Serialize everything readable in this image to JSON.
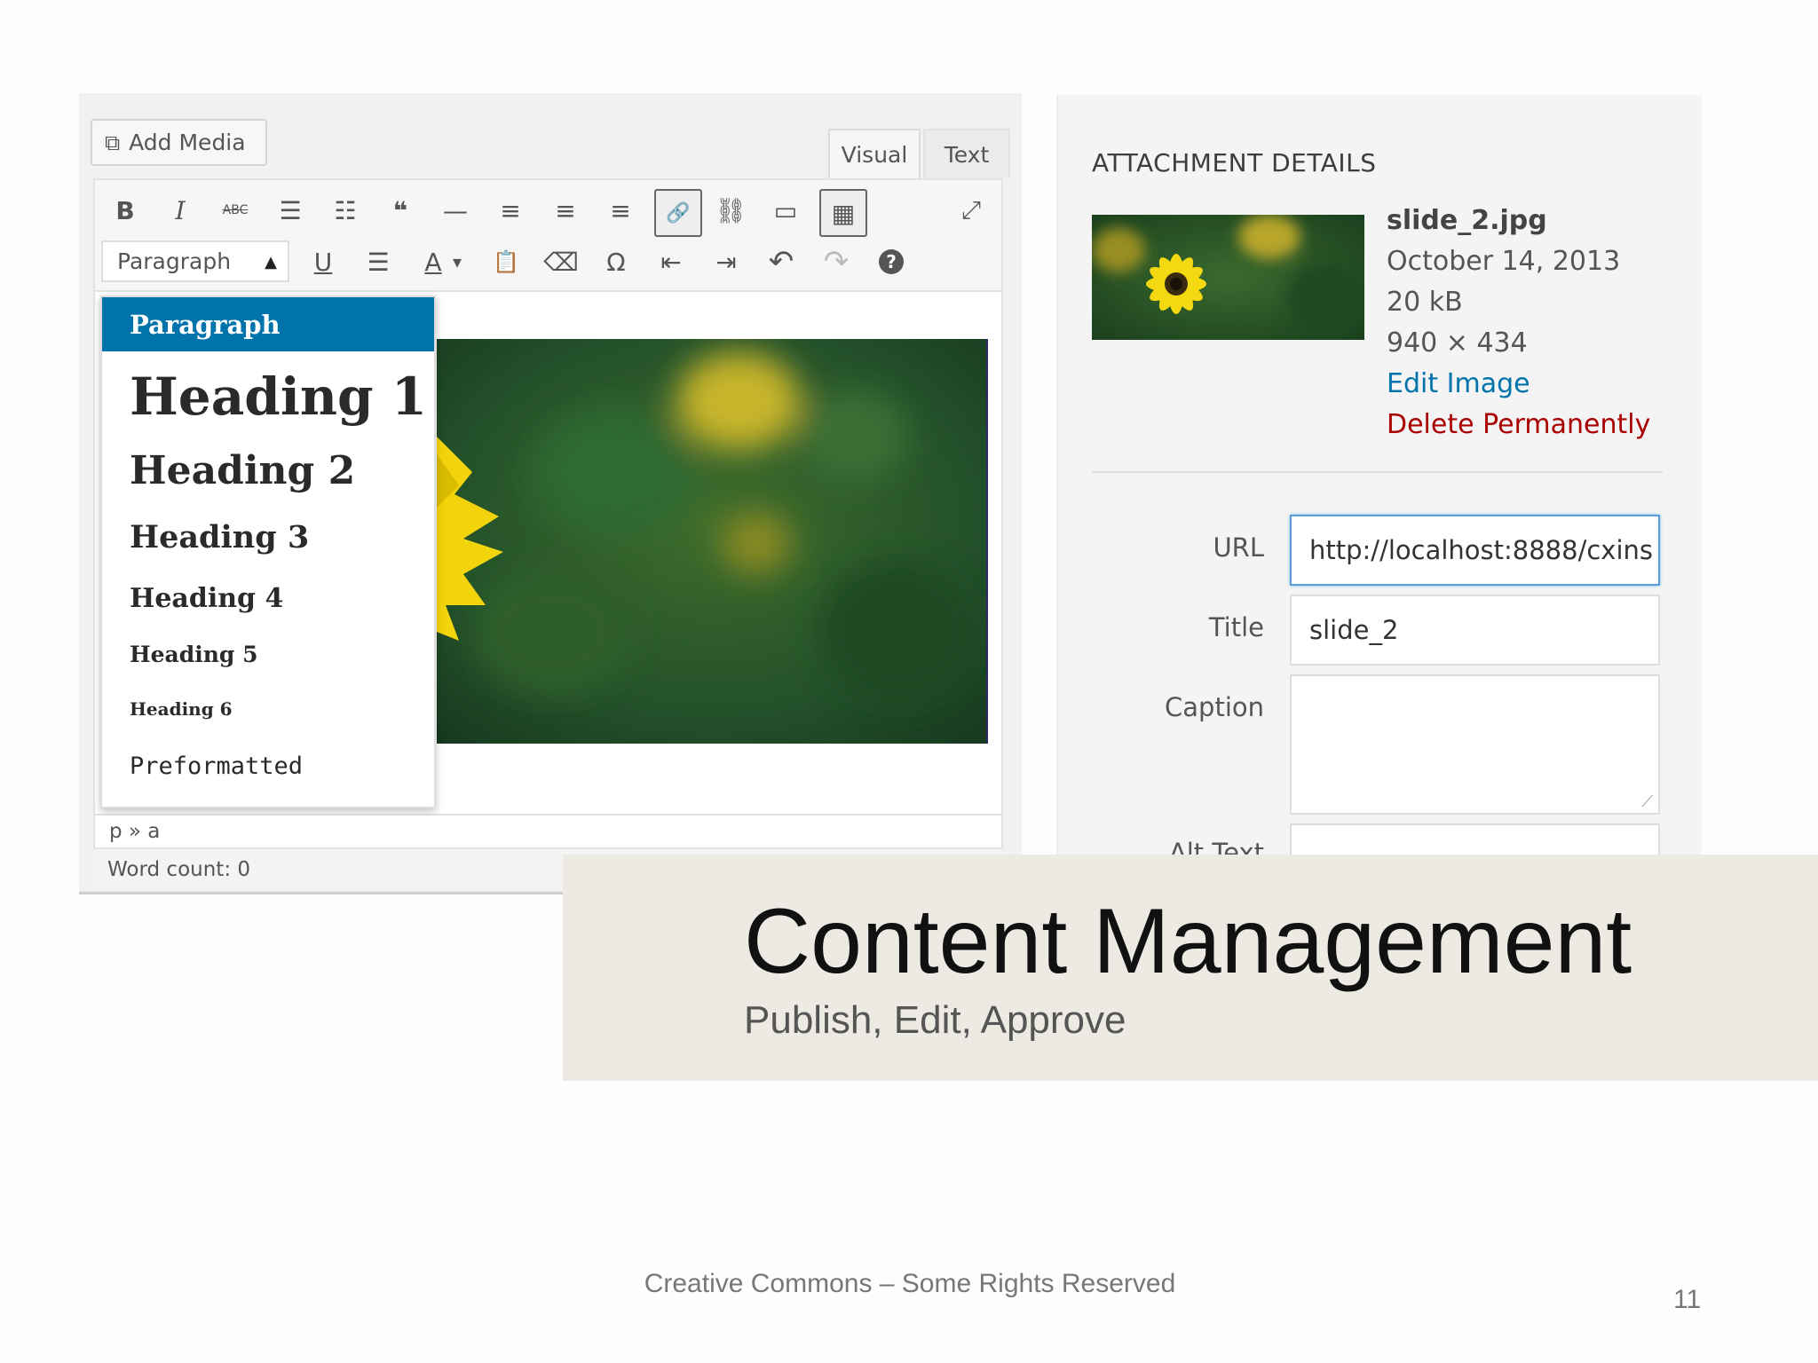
{
  "editor": {
    "add_media_label": "Add Media",
    "tabs": [
      {
        "label": "Visual"
      },
      {
        "label": "Text"
      }
    ],
    "toolbar_row1": [
      {
        "icon": "bold-icon",
        "glyph": "B"
      },
      {
        "icon": "italic-icon",
        "glyph": "I"
      },
      {
        "icon": "strikethrough-icon",
        "glyph": "ABC"
      },
      {
        "icon": "bulleted-list-icon",
        "glyph": "☰"
      },
      {
        "icon": "numbered-list-icon",
        "glyph": "☷"
      },
      {
        "icon": "blockquote-icon",
        "glyph": "❝"
      },
      {
        "icon": "horizontal-line-icon",
        "glyph": "—"
      },
      {
        "icon": "align-left-icon",
        "glyph": "≡"
      },
      {
        "icon": "align-center-icon",
        "glyph": "≡"
      },
      {
        "icon": "align-right-icon",
        "glyph": "≡"
      },
      {
        "icon": "link-icon",
        "glyph": "🔗"
      },
      {
        "icon": "unlink-icon",
        "glyph": "⛓"
      },
      {
        "icon": "read-more-icon",
        "glyph": "▭"
      },
      {
        "icon": "toolbar-toggle-icon",
        "glyph": "▦"
      },
      {
        "icon": "fullscreen-icon",
        "glyph": "⤢"
      }
    ],
    "format_select": {
      "selected": "Paragraph"
    },
    "toolbar_row2": [
      {
        "icon": "underline-icon",
        "glyph": "U"
      },
      {
        "icon": "justify-icon",
        "glyph": "☰"
      },
      {
        "icon": "text-color-icon",
        "glyph": "A"
      },
      {
        "icon": "text-color-dropdown-icon",
        "glyph": "▾"
      },
      {
        "icon": "paste-as-text-icon",
        "glyph": "📋"
      },
      {
        "icon": "clear-formatting-icon",
        "glyph": "⌫"
      },
      {
        "icon": "special-character-icon",
        "glyph": "Ω"
      },
      {
        "icon": "outdent-icon",
        "glyph": "⇤"
      },
      {
        "icon": "indent-icon",
        "glyph": "⇥"
      },
      {
        "icon": "undo-icon",
        "glyph": "↶"
      },
      {
        "icon": "redo-icon",
        "glyph": "↷"
      },
      {
        "icon": "help-icon",
        "glyph": "?"
      }
    ],
    "format_options": [
      "Paragraph",
      "Heading 1",
      "Heading 2",
      "Heading 3",
      "Heading 4",
      "Heading 5",
      "Heading 6",
      "Preformatted"
    ],
    "path": "p » a",
    "word_count": "Word count: 0"
  },
  "attachment": {
    "heading": "ATTACHMENT DETAILS",
    "filename": "slide_2.jpg",
    "date": "October 14, 2013",
    "size": "20 kB",
    "dimensions": "940 × 434",
    "edit_link": "Edit Image",
    "delete_link": "Delete Permanently",
    "fields": {
      "url_label": "URL",
      "url_value": "http://localhost:8888/cxins",
      "title_label": "Title",
      "title_value": "slide_2",
      "caption_label": "Caption",
      "caption_value": "",
      "alt_label": "Alt Text"
    },
    "colors": {
      "link": "#0073aa",
      "delete": "#a00",
      "focus": "#5b9dd9"
    }
  },
  "slide": {
    "title": "Content Management",
    "subtitle": "Publish, Edit, Approve",
    "footer": "Creative Commons – Some Rights Reserved",
    "page_number": "11"
  }
}
